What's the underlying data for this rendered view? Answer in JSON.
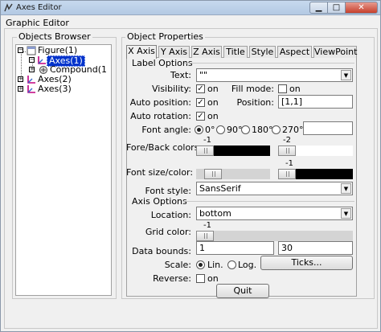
{
  "window": {
    "title": "Axes Editor"
  },
  "menu": {
    "label": "Graphic Editor"
  },
  "objects_browser": {
    "label": "Objects Browser",
    "nodes": [
      "Figure(1)",
      "Axes(1)",
      "Compound(1",
      "Axes(2)",
      "Axes(3)"
    ]
  },
  "object_properties": {
    "label": "Object Properties",
    "tabs": [
      "X Axis",
      "Y Axis",
      "Z Axis",
      "Title",
      "Style",
      "Aspect",
      "ViewPoint"
    ],
    "label_options": {
      "section": "Label Options",
      "text_label": "Text:",
      "text_value": "\"\"",
      "visibility_label": "Visibility:",
      "visibility_on": "on",
      "fill_mode_label": "Fill mode:",
      "fill_mode_on": "on",
      "auto_position_label": "Auto position:",
      "auto_position_on": "on",
      "position_label": "Position:",
      "position_value": "[1,1]",
      "auto_rotation_label": "Auto rotation:",
      "auto_rotation_on": "on",
      "font_angle_label": "Font angle:",
      "font_angle_options": [
        "0°",
        "90°",
        "180°",
        "270°"
      ],
      "fore_back_label": "Fore/Back colors:",
      "fore_value": "-1",
      "back_value": "-2",
      "font_size_color_label": "Font size/color:",
      "font_color_value": "-1",
      "font_style_label": "Font style:",
      "font_style_value": "SansSerif"
    },
    "axis_options": {
      "section": "Axis Options",
      "location_label": "Location:",
      "location_value": "bottom",
      "grid_color_label": "Grid color:",
      "grid_color_value": "-1",
      "data_bounds_label": "Data bounds:",
      "data_bounds_min": "1",
      "data_bounds_max": "30",
      "scale_label": "Scale:",
      "scale_lin": "Lin.",
      "scale_log": "Log.",
      "ticks_button": "Ticks...",
      "reverse_label": "Reverse:",
      "reverse_on": "on"
    },
    "quit_button": "Quit"
  }
}
